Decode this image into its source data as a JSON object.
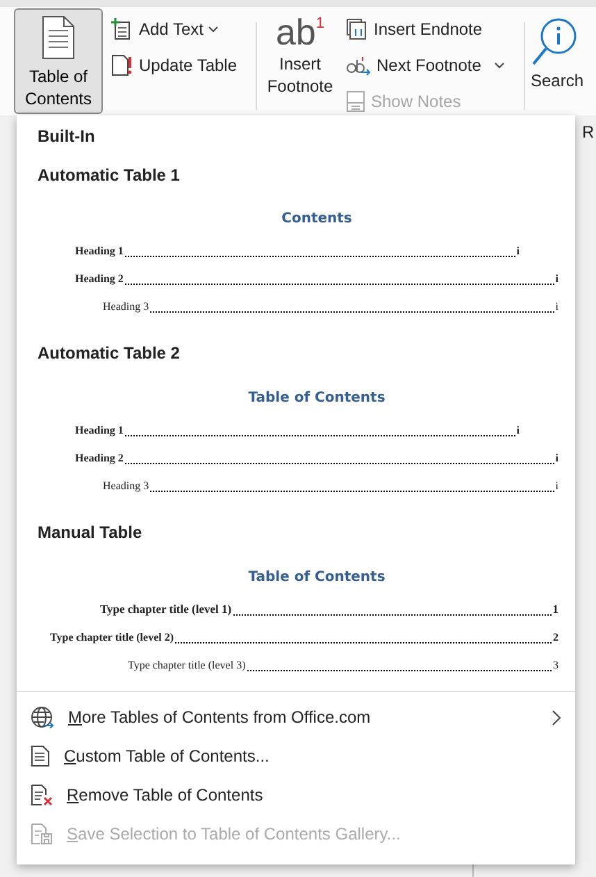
{
  "ribbon": {
    "toc_button": {
      "label": "Table of Contents",
      "expanded": true
    },
    "add_text": {
      "label": "Add Text"
    },
    "update_table": {
      "label": "Update Table"
    },
    "footnote_button": {
      "glyph": "ab",
      "glyph_mark": "1",
      "label": "Insert Footnote"
    },
    "endnote_items": [
      {
        "label": "Insert Endnote",
        "kind": "endnote",
        "disabled": false,
        "dropdown": false
      },
      {
        "label": "Next Footnote",
        "kind": "next",
        "disabled": false,
        "dropdown": true
      },
      {
        "label": "Show Notes",
        "kind": "notes",
        "disabled": true,
        "dropdown": false
      }
    ],
    "search_button": {
      "label": "Search"
    },
    "cut_tab": "R"
  },
  "menu": {
    "section_label": "Built-In",
    "gallery": [
      {
        "title": "Automatic Table 1",
        "preview_title": "Contents",
        "entries": [
          {
            "kind": "h1",
            "text": "Heading 1",
            "page": "i"
          },
          {
            "kind": "h2",
            "text": "Heading 2",
            "page": "i"
          },
          {
            "kind": "h3",
            "text": "Heading 3",
            "page": "i"
          }
        ]
      },
      {
        "title": "Automatic Table 2",
        "preview_title": "Table of Contents",
        "entries": [
          {
            "kind": "h1",
            "text": "Heading 1",
            "page": "i"
          },
          {
            "kind": "h2",
            "text": "Heading 2",
            "page": "i"
          },
          {
            "kind": "h3",
            "text": "Heading 3",
            "page": "i"
          }
        ]
      },
      {
        "title": "Manual Table",
        "preview_title": "Table of Contents",
        "entries": [
          {
            "kind": "l1",
            "text": "Type chapter title (level 1)",
            "page": "1"
          },
          {
            "kind": "l2",
            "text": "Type chapter title (level 2)",
            "page": "2"
          },
          {
            "kind": "l3",
            "text": "Type chapter title (level 3)",
            "page": "3"
          }
        ]
      }
    ],
    "items": [
      {
        "kind": "globe",
        "access_key": "M",
        "label_rest": "ore Tables of Contents from Office.com",
        "submenu": true,
        "disabled": false
      },
      {
        "kind": "doc",
        "access_key": "C",
        "label_rest": "ustom Table of Contents...",
        "submenu": false,
        "disabled": false
      },
      {
        "kind": "remove",
        "access_key": "R",
        "label_rest": "emove Table of Contents",
        "submenu": false,
        "disabled": false
      },
      {
        "kind": "save",
        "access_key": "S",
        "label_rest": "ave Selection to Table of Contents Gallery...",
        "submenu": false,
        "disabled": true
      }
    ]
  }
}
